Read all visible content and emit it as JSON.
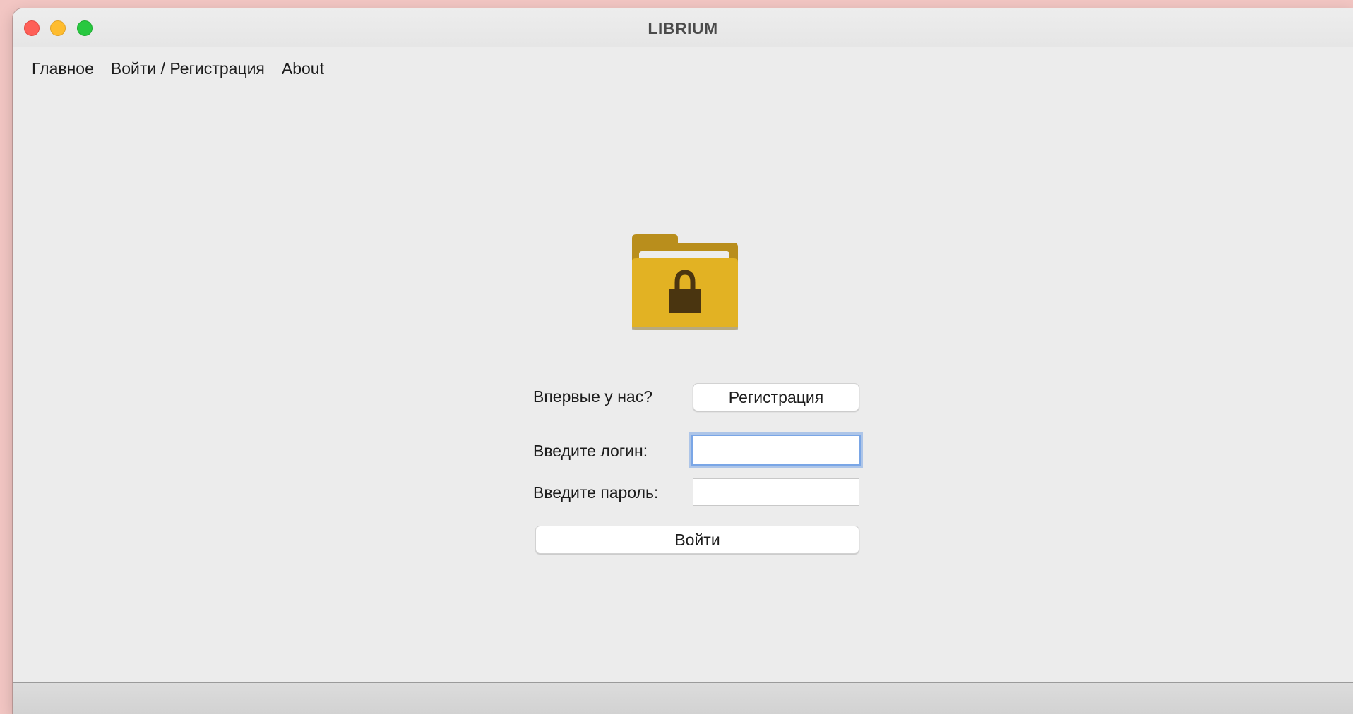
{
  "window": {
    "title": "LIBRIUM"
  },
  "menu": {
    "items": [
      "Главное",
      "Войти / Регистрация",
      "About"
    ]
  },
  "logo": {
    "icon": "locked-folder-icon",
    "folder_color": "#e2b223",
    "folder_dark_color": "#b98e1c",
    "lock_color": "#4a3510"
  },
  "signup": {
    "prompt": "Впервые у нас?",
    "button_label": "Регистрация"
  },
  "login": {
    "login_label": "Введите логин:",
    "login_value": "",
    "password_label": "Введите пароль:",
    "password_value": "",
    "submit_label": "Войти"
  },
  "colors": {
    "focus_ring": "#7aa6e6",
    "window_bg": "#ececec"
  }
}
